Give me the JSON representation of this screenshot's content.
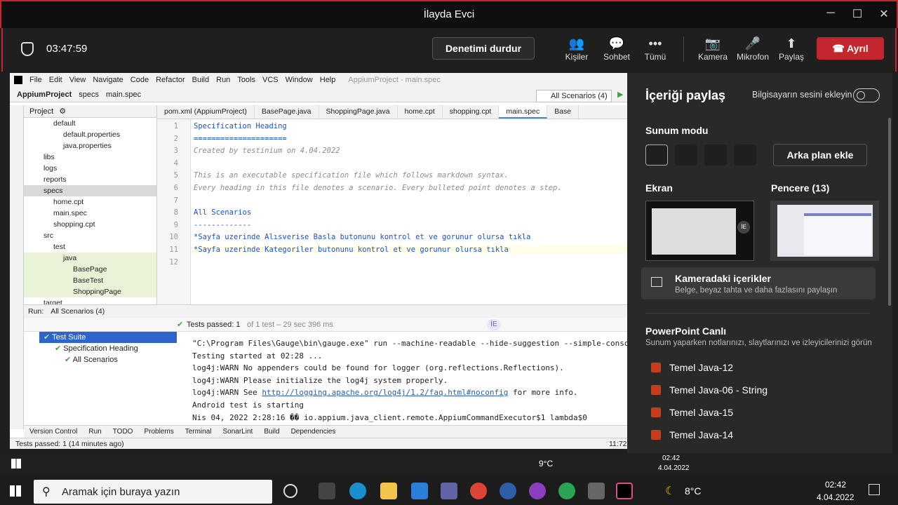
{
  "window": {
    "title": "İlayda Evci",
    "min": "─",
    "max": "☐",
    "close": "✕"
  },
  "meeting": {
    "timer": "03:47:59",
    "stop_recording": "Denetimi durdur",
    "people": "Kişiler",
    "chat": "Sohbet",
    "more": "Tümü",
    "camera": "Kamera",
    "mic": "Mikrofon",
    "share": "Paylaş",
    "leave": "Ayrıl"
  },
  "ide": {
    "menu": [
      "File",
      "Edit",
      "View",
      "Navigate",
      "Code",
      "Refactor",
      "Build",
      "Run",
      "Tools",
      "VCS",
      "Window",
      "Help"
    ],
    "project_title": "AppiumProject - main.spec",
    "breadcrumb": [
      "AppiumProject",
      "specs",
      "main.spec"
    ],
    "run_config": "All Scenarios (4)",
    "project_label": "Project",
    "tree": [
      "default",
      "default.properties",
      "java.properties",
      "libs",
      "logs",
      "reports",
      "specs",
      "home.cpt",
      "main.spec",
      "shopping.cpt",
      "src",
      "test",
      "java",
      "BasePage",
      "BaseTest",
      "ShoppingPage",
      "target"
    ],
    "tabs": [
      "pom.xml (AppiumProject)",
      "BasePage.java",
      "ShoppingPage.java",
      "home.cpt",
      "shopping.cpt",
      "main.spec",
      "Base"
    ],
    "code": [
      {
        "n": "1",
        "t": "Specification Heading"
      },
      {
        "n": "2",
        "t": "====================="
      },
      {
        "n": "3",
        "t": "Created by testinium on 4.04.2022"
      },
      {
        "n": "4",
        "t": ""
      },
      {
        "n": "5",
        "t": "This is an executable specification file which follows markdown syntax."
      },
      {
        "n": "6",
        "t": "Every heading in this file denotes a scenario. Every bulleted point denotes a step."
      },
      {
        "n": "7",
        "t": ""
      },
      {
        "n": "8",
        "t": "All Scenarios"
      },
      {
        "n": "9",
        "t": "-------------"
      },
      {
        "n": "10",
        "t": "*Sayfa uzerinde Alısverise Basla butonunu kontrol et ve gorunur olursa tıkla"
      },
      {
        "n": "11",
        "t": "*Sayfa uzerinde Kategoriler butonunu kontrol et ve gorunur olursa tıkla"
      },
      {
        "n": "12",
        "t": ""
      }
    ],
    "run_label": "Run:",
    "run_tab": "All Scenarios (4)",
    "tests_passed": "Tests passed: 1",
    "tests_detail": "of 1 test – 29 sec 396 ms",
    "suite": [
      "Test Suite",
      "Specification Heading",
      "All Scenarios"
    ],
    "console": [
      "\"C:\\Program Files\\Gauge\\bin\\gauge.exe\" run --machine-readable --hide-suggestion --simple-console",
      "Testing started at 02:28 ...",
      "log4j:WARN No appenders could be found for logger (org.reflections.Reflections).",
      "log4j:WARN Please initialize the log4j system properly.",
      "log4j:WARN See ",
      "Android test is starting",
      "Nis 04, 2022 2:28:16 �� io.appium.java_client.remote.AppiumCommandExecutor$1 lambda$0"
    ],
    "console_link": "http://logging.apache.org/log4j/1.2/faq.html#noconfig",
    "console_link_suffix": " for more info.",
    "bottom_tabs": [
      "Version Control",
      "Run",
      "TODO",
      "Problems",
      "Terminal",
      "SonarLint",
      "Build",
      "Dependencies"
    ],
    "status": "Tests passed: 1 (14 minutes ago)",
    "time": "11:72",
    "avatar": "İE"
  },
  "share": {
    "title": "İçeriği paylaş",
    "sound_label": "Bilgisayarın sesini ekleyin",
    "present_mode": "Sunum modu",
    "bg_button": "Arka plan ekle",
    "screen_label": "Ekran",
    "window_label": "Pencere (13)",
    "camera_title": "Kameradaki içerikler",
    "camera_sub": "Belge, beyaz tahta ve daha fazlasını paylaşın",
    "ppt_title": "PowerPoint Canlı",
    "ppt_sub": "Sunum yaparken notlarınızı, slaytlarınızı ve izleyicilerinizi görün",
    "files": [
      "Temel Java-12",
      "Temel Java-06 - String",
      "Temel Java-15",
      "Temel Java-14"
    ]
  },
  "inner_taskbar": {
    "weather": "9°C",
    "time": "02:42",
    "date": "4.04.2022"
  },
  "taskbar": {
    "search": "Aramak için buraya yazın",
    "weather": "8°C",
    "time": "02:42",
    "date": "4.04.2022"
  },
  "colors": {
    "accent": "#c4262e",
    "teams_purple": "#6264a7",
    "code_blue": "#1750eb",
    "comment": "#8c8c8c"
  }
}
